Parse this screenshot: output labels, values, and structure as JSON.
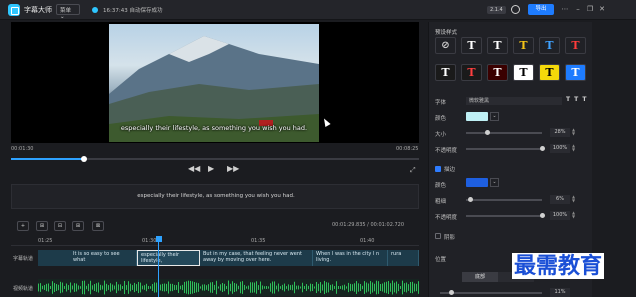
{
  "titlebar": {
    "app_name": "字幕大师",
    "menu_label": "菜单 ⌄",
    "save_status": "16:37:43 自动保存成功",
    "version": "2.1.4",
    "export_label": "导出",
    "accent": "#1e7cff"
  },
  "preview": {
    "subtitle_text": "especially their lifestyle, as something you wish you had.",
    "current_time": "00:01:30",
    "total_time": "00:08:25",
    "progress": 0.18,
    "controls": {
      "prev": "◀◀",
      "play": "▶",
      "next": "▶▶",
      "fullscreen": "⤢"
    }
  },
  "caption_edit": {
    "text": "especially their lifestyle, as something you wish you had."
  },
  "timeline": {
    "tools": [
      "+",
      "⊞",
      "⊟",
      "⊞",
      "⊡",
      "⊠"
    ],
    "time_readout": "00:01:29.835  /  00:01:02.720",
    "ruler": [
      "01:25",
      "01:30",
      "01:35",
      "01:40"
    ],
    "subtitle_track_label": "字幕轨道",
    "audio_track_label": "视频轨道",
    "clips": [
      {
        "text": "It is so easy to see what"
      },
      {
        "text": "especially their lifestyle,"
      },
      {
        "text": "But in my case, that feeling never went away by moving over here."
      },
      {
        "text": "When I was in the city I n living."
      },
      {
        "text": "rura"
      }
    ]
  },
  "style_panel": {
    "title": "预设样式",
    "presets_row1": [
      {
        "glyph": "⃠",
        "fg": "#cfcfcf",
        "bg": "#202126"
      },
      {
        "glyph": "T",
        "fg": "#ffffff",
        "bg": "#202126"
      },
      {
        "glyph": "T",
        "fg": "#ffffff",
        "bg": "#202126"
      },
      {
        "glyph": "T",
        "fg": "#f5c518",
        "bg": "#202126"
      },
      {
        "glyph": "T",
        "fg": "#3fa2ff",
        "bg": "#202126"
      },
      {
        "glyph": "T",
        "fg": "#ff3b3b",
        "bg": "#202126"
      }
    ],
    "presets_row2": [
      {
        "glyph": "T",
        "fg": "#ffffff",
        "bg": "#1a1a1a"
      },
      {
        "glyph": "T",
        "fg": "#ff4040",
        "bg": "#1a1a1a"
      },
      {
        "glyph": "T",
        "fg": "#ffffff",
        "bg": "#3a0000"
      },
      {
        "glyph": "T",
        "fg": "#000000",
        "bg": "#ffffff"
      },
      {
        "glyph": "T",
        "fg": "#000000",
        "bg": "#f5d90a"
      },
      {
        "glyph": "T",
        "fg": "#ffffff",
        "bg": "#1e7cff"
      }
    ],
    "font_label": "字体",
    "font_value": "微软雅黑",
    "font_icons": "T T T",
    "color_label": "颜色",
    "text_color": "#bff0f5",
    "size_label": "大小",
    "size_value": "28%",
    "size_level": 0.28,
    "opacity_label": "不透明度",
    "opacity_value": "100%",
    "opacity_level": 1.0,
    "stroke_label": "描边",
    "stroke_color_label": "颜色",
    "stroke_color": "#1e5fe0",
    "thickness_label": "粗细",
    "thickness_value": "6%",
    "thickness_level": 0.06,
    "stroke_opacity_label": "不透明度",
    "stroke_opacity_value": "100%",
    "stroke_opacity_level": 1.0,
    "shadow_label": "阴影",
    "position_label": "位置",
    "position_tabs": [
      "底部",
      "中"
    ],
    "bottom_value": "11%",
    "bottom_level": 0.11
  },
  "watermark": "最需教育"
}
